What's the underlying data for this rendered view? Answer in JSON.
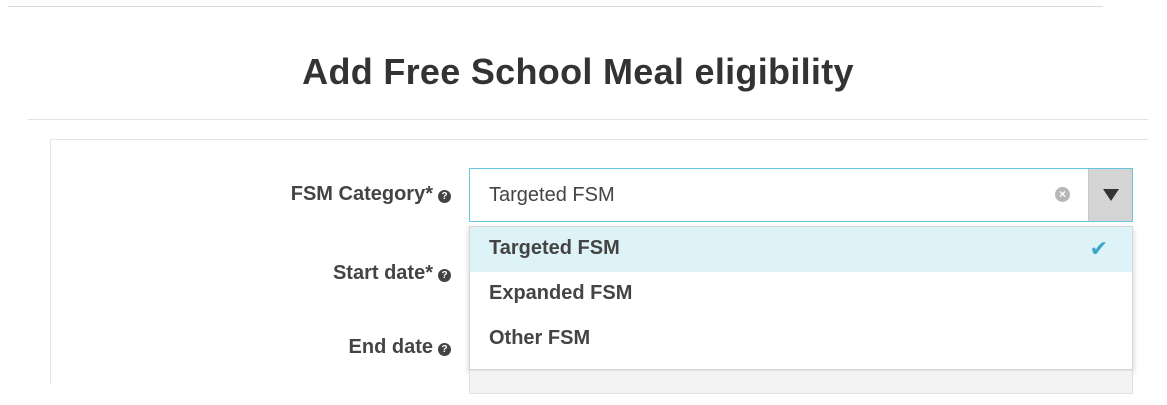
{
  "modal": {
    "title": "Add Free School Meal eligibility"
  },
  "form": {
    "fsm_category": {
      "label": "FSM Category*",
      "value": "Targeted FSM",
      "clear_icon": "clear-circle-icon",
      "caret_icon": "caret-down-icon",
      "options": [
        {
          "label": "Targeted FSM",
          "selected": true
        },
        {
          "label": "Expanded FSM",
          "selected": false
        },
        {
          "label": "Other FSM",
          "selected": false
        }
      ]
    },
    "start_date": {
      "label": "Start date*"
    },
    "end_date": {
      "label": "End date"
    },
    "help_icon": "question-circle-icon"
  },
  "colors": {
    "focus_border": "#66c7da",
    "selected_bg": "#def3f7",
    "check": "#39a9c7"
  }
}
